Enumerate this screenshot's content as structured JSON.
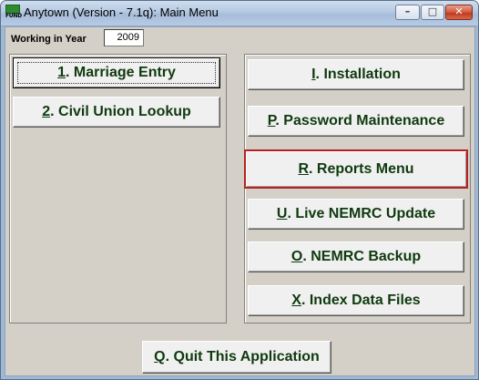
{
  "window": {
    "title": "Anytown (Version - 7.1q):  Main Menu",
    "icon": "fund-app-icon",
    "icon_text": "FUND",
    "controls": {
      "minimize": "minimize-icon",
      "maximize": "maximize-icon",
      "close": "close-icon"
    }
  },
  "working_year": {
    "label": "Working in Year",
    "value": "2009"
  },
  "left_buttons": [
    {
      "key": "1",
      "label": ". Marriage Entry",
      "focused": true
    },
    {
      "key": "2",
      "label": ". Civil Union Lookup"
    }
  ],
  "right_buttons": [
    {
      "key": "I",
      "label": ".  Installation"
    },
    {
      "key": "P",
      "label": ".  Password Maintenance"
    },
    {
      "key": "R",
      "label": ".  Reports Menu",
      "highlighted": true
    },
    {
      "key": "U",
      "label": ". Live NEMRC Update"
    },
    {
      "key": "O",
      "label": ". NEMRC Backup"
    },
    {
      "key": "X",
      "label": ".  Index Data Files"
    }
  ],
  "quit_button": {
    "key": "Q",
    "label": ".  Quit This Application"
  },
  "colors": {
    "button_text": "#0f3a0f",
    "highlight_border": "#b52222",
    "client_bg": "#d4d0c8"
  }
}
